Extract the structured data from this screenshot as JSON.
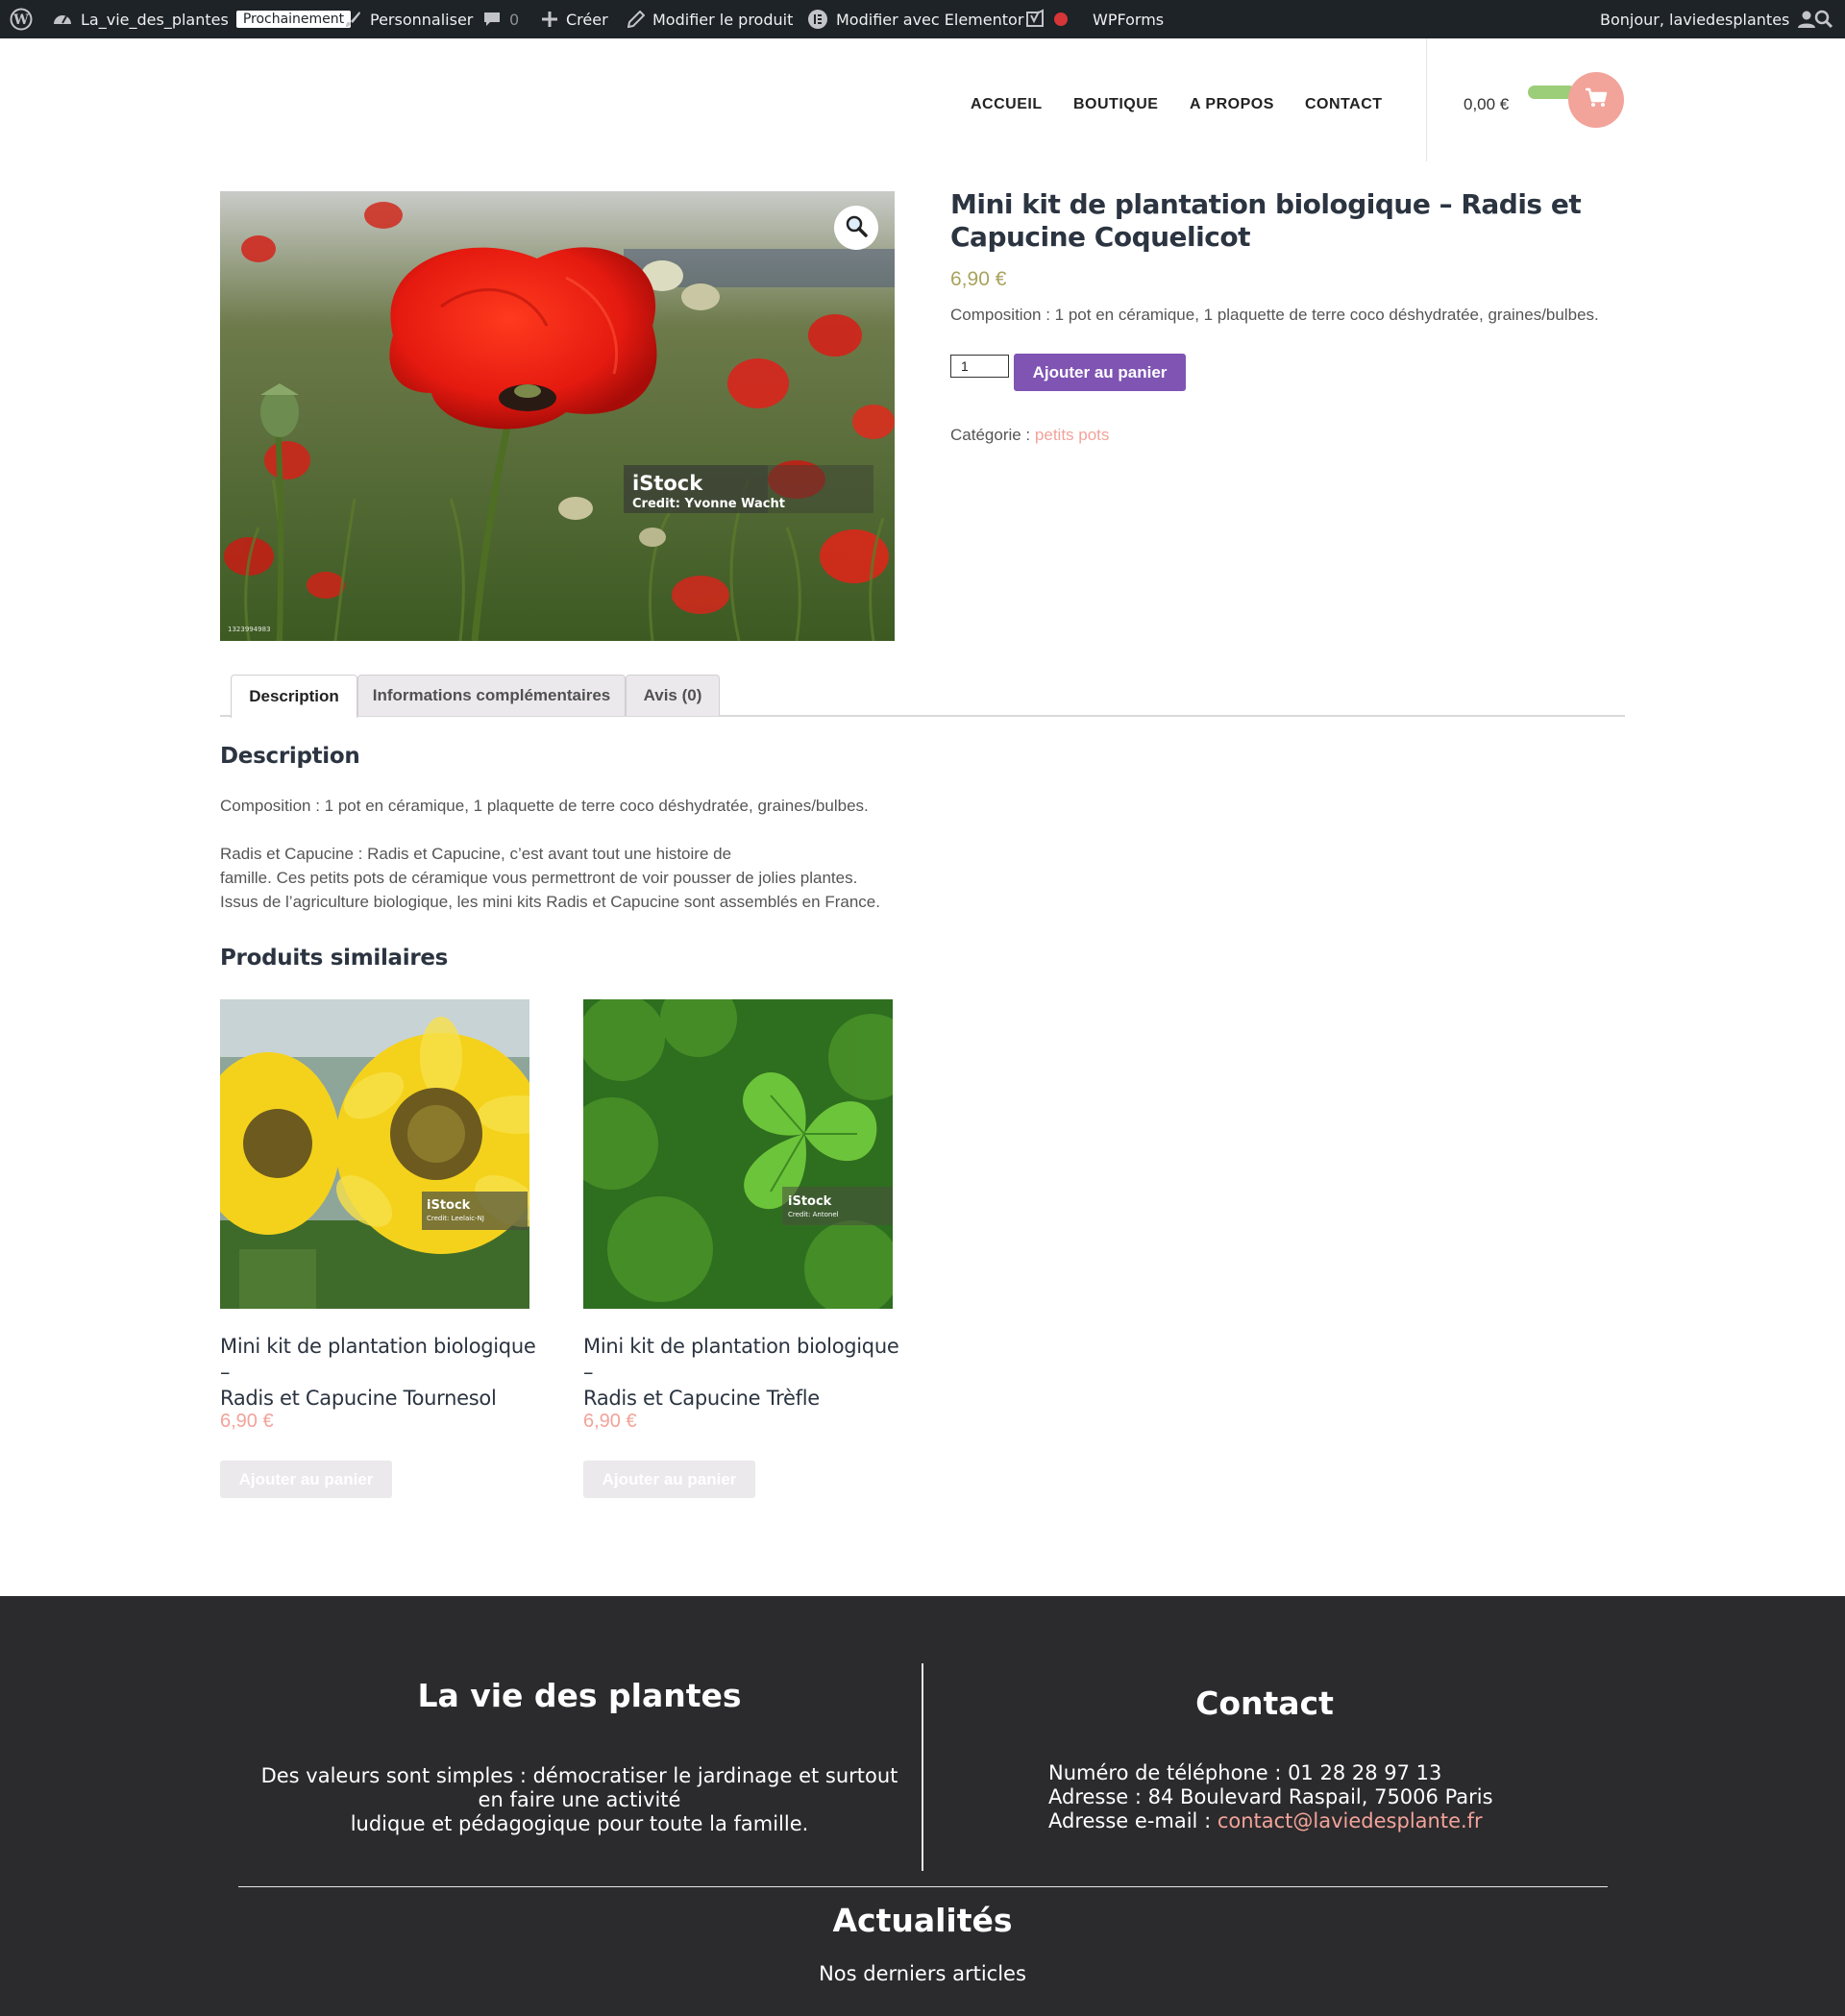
{
  "admin_bar": {
    "site_name": "La_vie_des_plantes",
    "badge": "Prochainement",
    "customize": "Personnaliser",
    "comments_count": "0",
    "create": "Créer",
    "edit_product": "Modifier le produit",
    "edit_elementor": "Modifier avec Elementor",
    "wpforms": "WPForms",
    "greeting": "Bonjour, laviedesplantes"
  },
  "nav": {
    "items": [
      "ACCUEIL",
      "BOUTIQUE",
      "A PROPOS",
      "CONTACT"
    ],
    "cart_total": "0,00 €"
  },
  "product": {
    "title": "Mini kit de plantation biologique – Radis et Capucine Coquelicot",
    "price": "6,90 €",
    "short_description": "Composition : 1 pot en céramique, 1 plaquette de terre coco déshydratée, graines/bulbes.",
    "quantity": "1",
    "add_to_cart": "Ajouter au panier",
    "category_label": "Catégorie :",
    "category_value": "petits pots",
    "image_watermark": "iStock",
    "image_credit": "Credit: Yvonne Wacht",
    "image_id": "1323994983"
  },
  "tabs": [
    "Description",
    "Informations complémentaires",
    "Avis (0)"
  ],
  "description": {
    "heading": "Description",
    "para1": "Composition : 1 pot en céramique, 1 plaquette de terre coco déshydratée, graines/bulbes.",
    "para2_line1": "Radis et Capucine : Radis et Capucine, c’est avant tout une histoire de",
    "para2_line2": "famille. Ces petits pots de céramique vous permettront de voir pousser de jolies plantes.",
    "para2_line3": "Issus de l’agriculture biologique, les mini kits Radis et Capucine sont assemblés en France."
  },
  "related": {
    "heading": "Produits similaires",
    "items": [
      {
        "title_line1": "Mini kit de plantation biologique –",
        "title_line2": "Radis et Capucine Tournesol",
        "price": "6,90 €",
        "button": "Ajouter au panier",
        "watermark": "iStock",
        "credit": "Credit: Leelaic-NJ"
      },
      {
        "title_line1": "Mini kit de plantation biologique –",
        "title_line2": "Radis et Capucine Trèfle",
        "price": "6,90 €",
        "button": "Ajouter au panier",
        "watermark": "iStock",
        "credit": "Credit: Antonel"
      }
    ]
  },
  "footer": {
    "about_title": "La vie des plantes",
    "about_line1": "Des valeurs sont simples : démocratiser le jardinage et surtout",
    "about_line2": "en faire une activité",
    "about_line3": "ludique et pédagogique pour toute la famille.",
    "contact_title": "Contact",
    "phone": "Numéro de téléphone : 01 28 28 97 13",
    "address": "Adresse : 84 Boulevard Raspail, 75006 Paris",
    "email_label": "Adresse e-mail : ",
    "email": "contact@laviedesplante.fr",
    "news_title": "Actualités",
    "news_sub": "Nos derniers articles"
  },
  "colors": {
    "admin_bar": "#1d2327",
    "accent_purple": "#7f54b3",
    "accent_pink": "#f2a39a",
    "accent_green": "#9ccd78",
    "price_olive": "#a8a35e",
    "footer_bg": "#2b2a2c"
  },
  "icons": [
    "wordpress-icon",
    "dashboard-icon",
    "brush-icon",
    "comment-icon",
    "plus-icon",
    "pencil-icon",
    "elementor-icon",
    "yoast-icon",
    "user-icon",
    "search-icon",
    "cart-icon",
    "zoom-icon"
  ]
}
